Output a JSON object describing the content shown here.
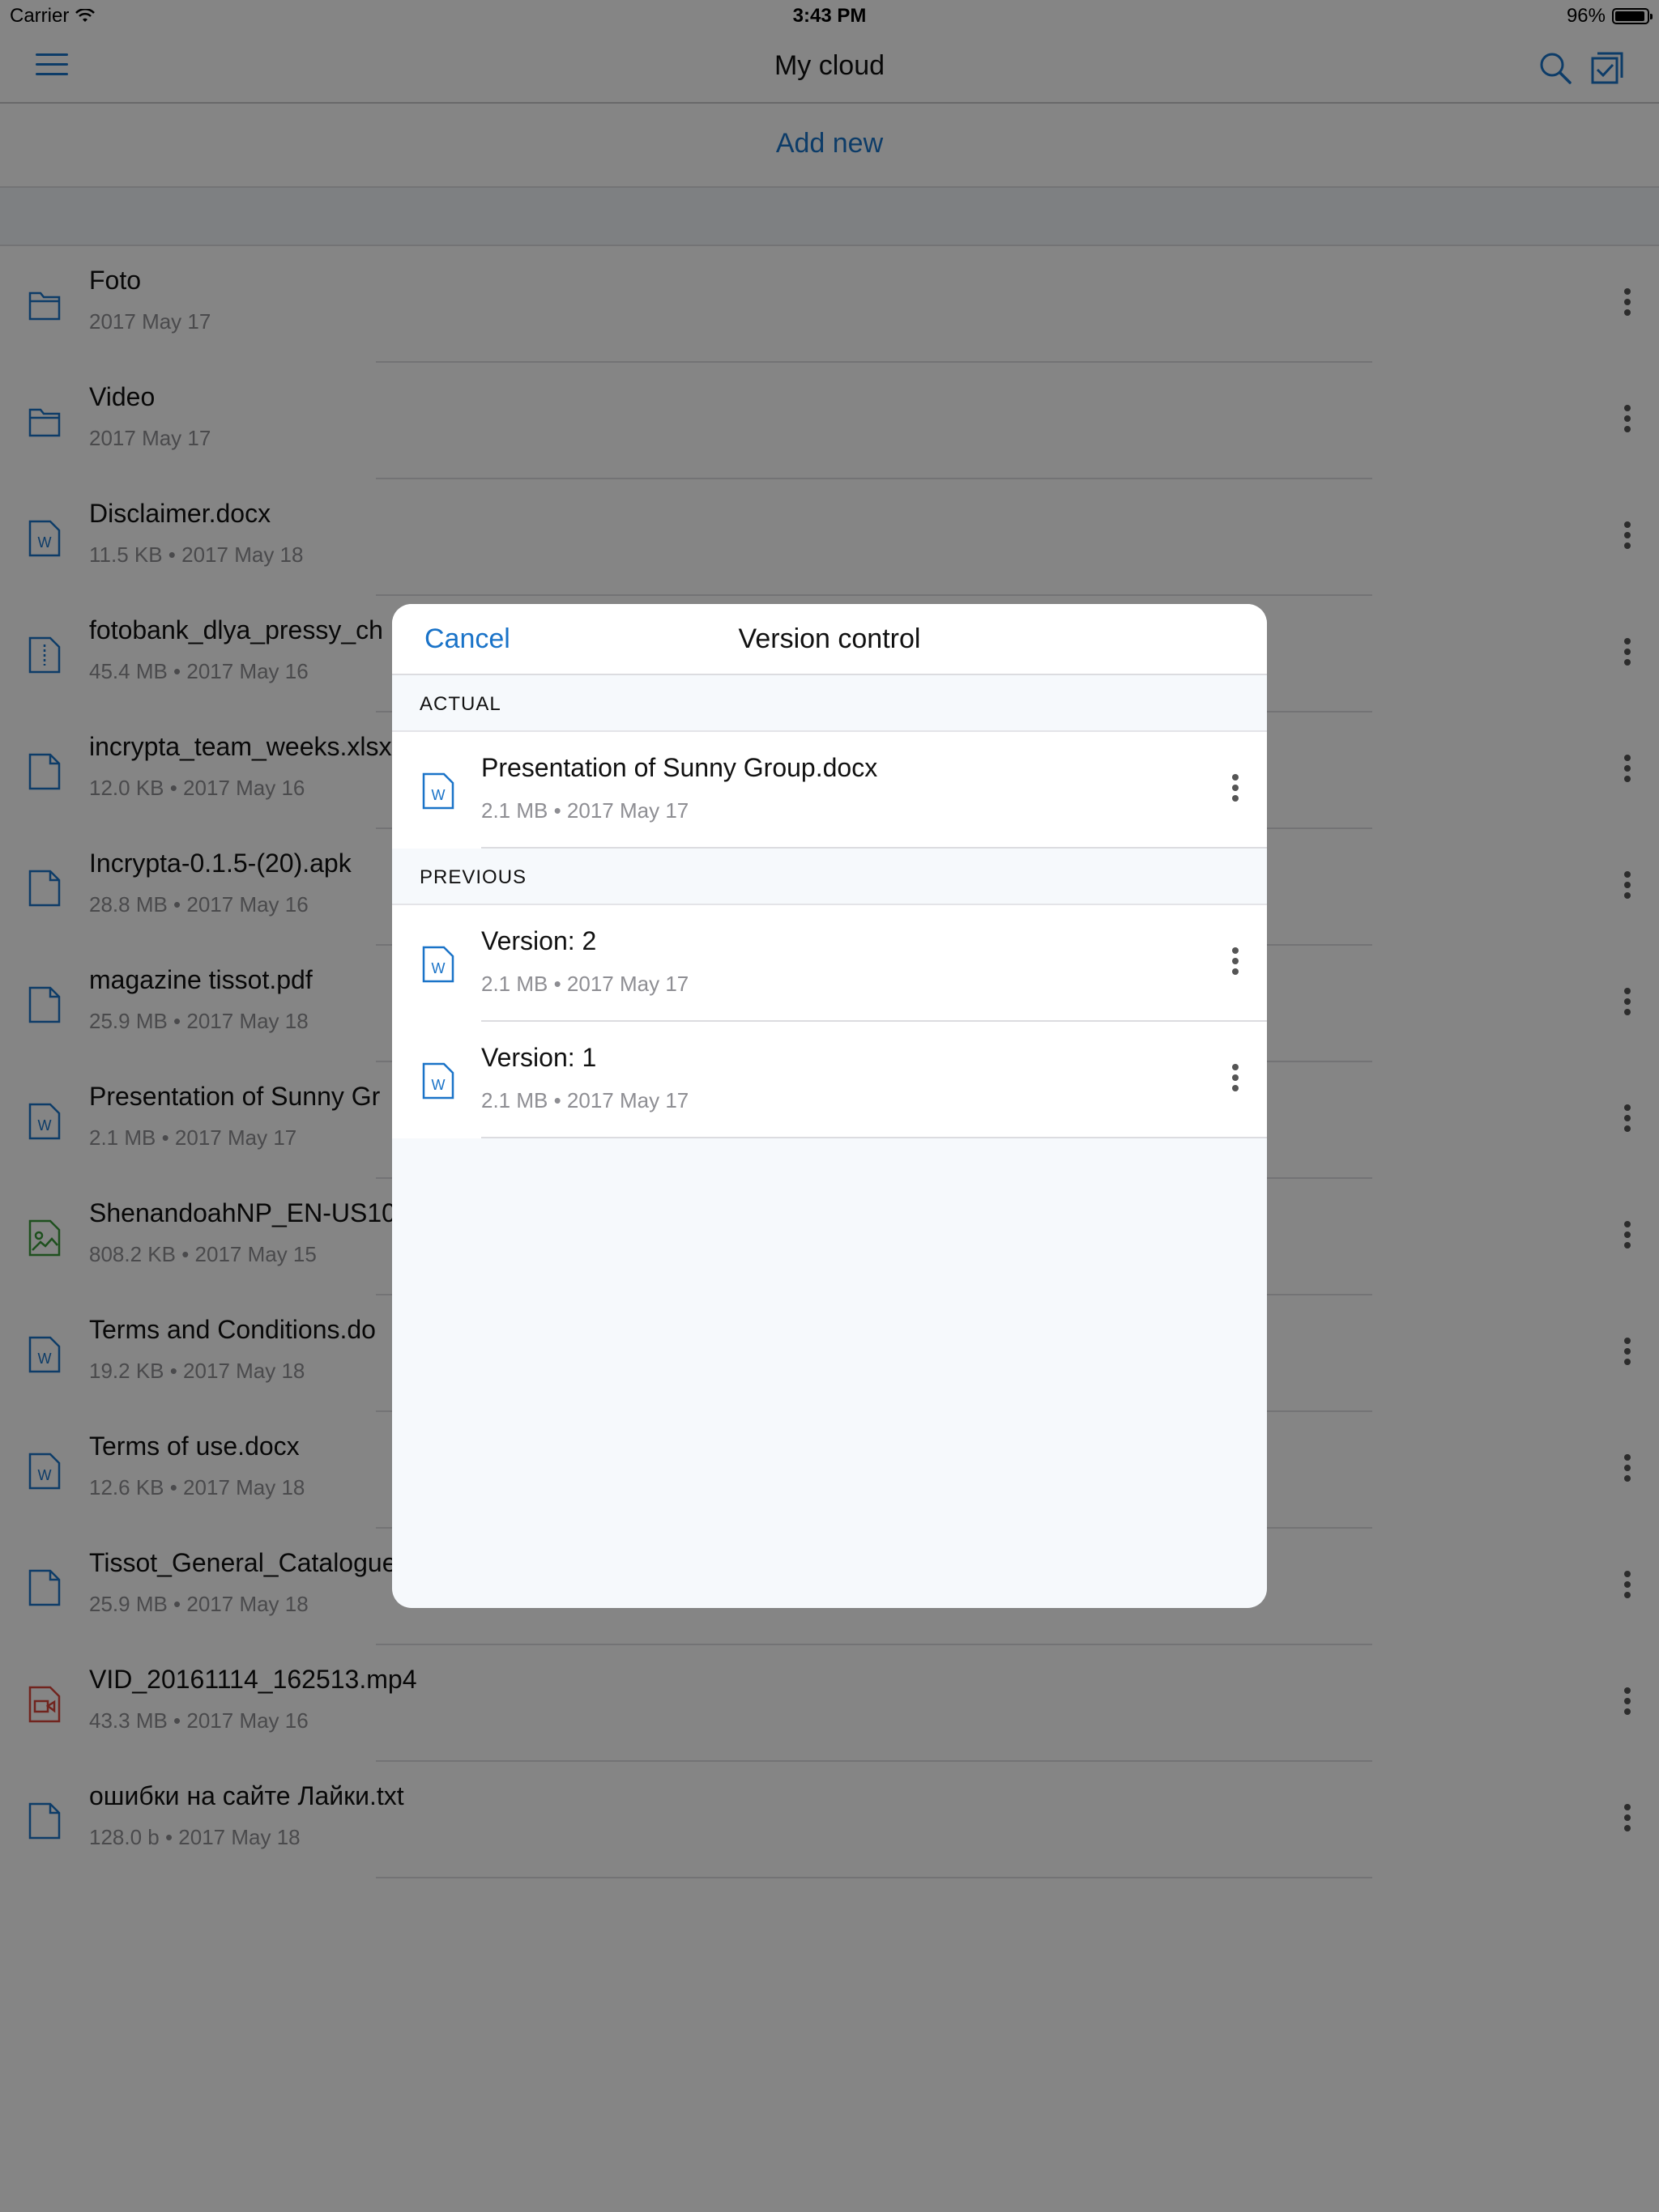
{
  "status_bar": {
    "carrier": "Carrier",
    "time": "3:43 PM",
    "battery": "96%",
    "battery_level": 0.96
  },
  "navbar": {
    "title": "My cloud",
    "menu_icon": "hamburger-menu-icon",
    "search_icon": "search-icon",
    "select_icon": "checklist-icon"
  },
  "add_new": {
    "label": "Add new"
  },
  "files": [
    {
      "name": "Foto",
      "meta": "2017 May 17",
      "icon": "folder-icon"
    },
    {
      "name": "Video",
      "meta": "2017 May 17",
      "icon": "folder-icon"
    },
    {
      "name": "Disclaimer.docx",
      "meta": "11.5 KB • 2017 May 18",
      "icon": "word-doc-icon"
    },
    {
      "name": "fotobank_dlya_pressy_ch",
      "meta": "45.4 MB • 2017 May 16",
      "icon": "archive-icon"
    },
    {
      "name": "incrypta_team_weeks.xlsx",
      "meta": "12.0 KB • 2017 May 16",
      "icon": "file-icon"
    },
    {
      "name": "Incrypta-0.1.5-(20).apk",
      "meta": "28.8 MB • 2017 May 16",
      "icon": "file-icon"
    },
    {
      "name": "magazine tissot.pdf",
      "meta": "25.9 MB • 2017 May 18",
      "icon": "file-icon"
    },
    {
      "name": "Presentation of Sunny Gr",
      "meta": "2.1 MB • 2017 May 17",
      "icon": "word-doc-icon"
    },
    {
      "name": "ShenandoahNP_EN-US10",
      "meta": "808.2 KB • 2017 May 15",
      "icon": "image-icon"
    },
    {
      "name": "Terms and Conditions.do",
      "meta": "19.2 KB • 2017 May 18",
      "icon": "word-doc-icon"
    },
    {
      "name": "Terms of use.docx",
      "meta": "12.6 KB • 2017 May 18",
      "icon": "word-doc-icon"
    },
    {
      "name": "Tissot_General_Catalogue",
      "meta": "25.9 MB • 2017 May 18",
      "icon": "file-icon"
    },
    {
      "name": "VID_20161114_162513.mp4",
      "meta": "43.3 MB • 2017 May 16",
      "icon": "video-icon"
    },
    {
      "name": "ошибки на сайте Лайки.txt",
      "meta": "128.0 b • 2017 May 18",
      "icon": "file-icon"
    }
  ],
  "modal": {
    "cancel_label": "Cancel",
    "title": "Version control",
    "actual_header": "ACTUAL",
    "actual": {
      "name": "Presentation of Sunny Group.docx",
      "meta": "2.1 MB • 2017 May 17",
      "icon": "word-doc-icon"
    },
    "previous_header": "PREVIOUS",
    "previous": [
      {
        "name": "Version: 2",
        "meta": "2.1 MB • 2017 May 17",
        "icon": "word-doc-icon"
      },
      {
        "name": "Version: 1",
        "meta": "2.1 MB • 2017 May 17",
        "icon": "word-doc-icon"
      }
    ]
  },
  "colors": {
    "accent": "#1a73c8",
    "image_icon": "#3a9a3a",
    "video_icon": "#d9453a",
    "overlay": "rgba(0,0,0,0.48)"
  }
}
